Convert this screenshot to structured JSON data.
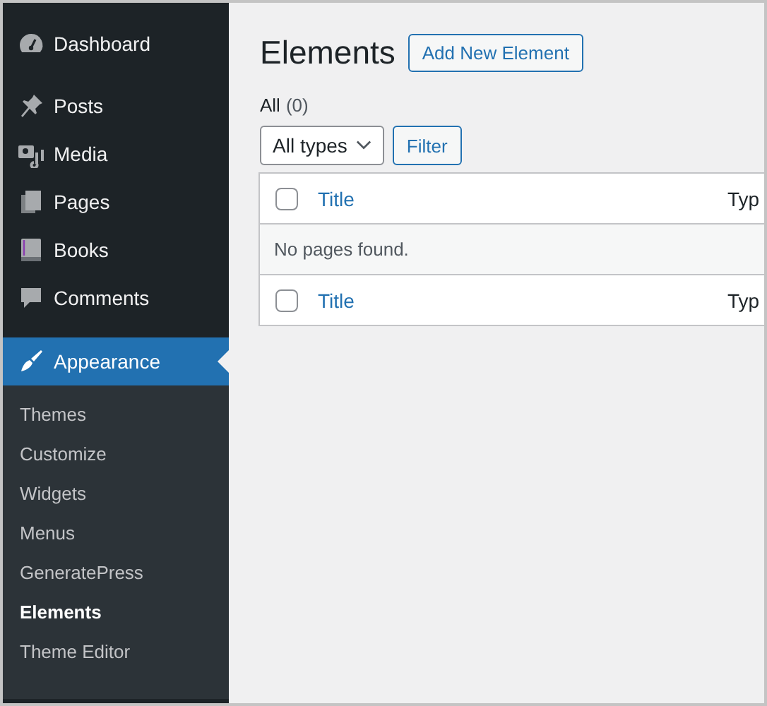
{
  "sidebar": {
    "items": [
      {
        "label": "Dashboard",
        "selected": false
      },
      {
        "label": "Posts",
        "selected": false
      },
      {
        "label": "Media",
        "selected": false
      },
      {
        "label": "Pages",
        "selected": false
      },
      {
        "label": "Books",
        "selected": false
      },
      {
        "label": "Comments",
        "selected": false
      },
      {
        "label": "Appearance",
        "selected": true,
        "children": [
          {
            "label": "Themes",
            "selected": false
          },
          {
            "label": "Customize",
            "selected": false
          },
          {
            "label": "Widgets",
            "selected": false
          },
          {
            "label": "Menus",
            "selected": false
          },
          {
            "label": "GeneratePress",
            "selected": false
          },
          {
            "label": "Elements",
            "selected": true
          },
          {
            "label": "Theme Editor",
            "selected": false
          }
        ]
      }
    ]
  },
  "page": {
    "title": "Elements",
    "add_button": "Add New Element",
    "filter_link": "All",
    "filter_count": "(0)",
    "type_select": "All types",
    "filter_button": "Filter",
    "table": {
      "columns": [
        "Title",
        "Typ"
      ],
      "header_checked": false,
      "empty_message": "No pages found.",
      "footer_columns": [
        "Title",
        "Typ"
      ],
      "footer_checked": false
    }
  }
}
